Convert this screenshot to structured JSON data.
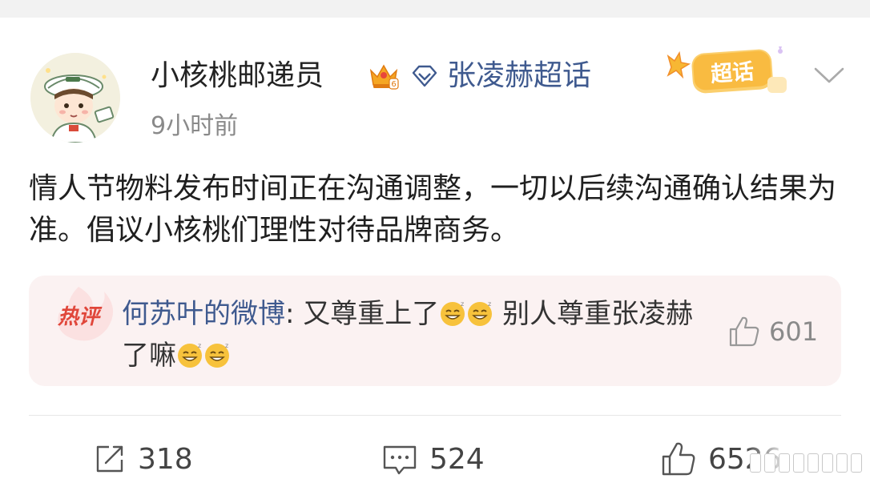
{
  "post": {
    "username": "小核桃邮递员",
    "supertopic_label": "张凌赫超话",
    "supertopic_badge": "超话",
    "timestamp": "9小时前",
    "text": "情人节物料发布时间正在沟通调整，一切以后续沟通确认结果为准。倡议小核桃们理性对待品牌商务。"
  },
  "hot_comment": {
    "tag": "热评",
    "author": "何苏叶的微博",
    "separator": ":",
    "text_part1": " 又尊重上了",
    "text_part2": " 别人尊重张凌赫了嘛",
    "likes": "601"
  },
  "actions": {
    "repost_count": "318",
    "comment_count": "524",
    "like_count": "6526"
  },
  "icons": {
    "crown": "crown-icon",
    "supertopic": "diamond-icon",
    "chevron": "chevron-down-icon",
    "thumbs_up": "thumbs-up-icon",
    "repost": "repost-icon",
    "comment": "comment-icon"
  },
  "colors": {
    "link_blue": "#3f5a8f",
    "hot_red": "#e0463a",
    "hot_bg": "#fbf2f2",
    "badge_orange": "#f5a623",
    "muted_gray": "#8a8a8a"
  }
}
